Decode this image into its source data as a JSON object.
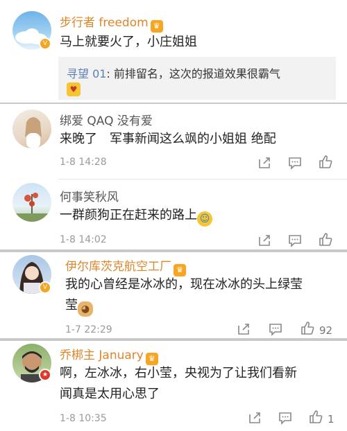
{
  "comments": [
    {
      "user": "步行者 freedom",
      "text": "马上就要火了，小庄姐姐",
      "reply": {
        "user": "寻望 01",
        "text": ": 前排留名，这次的报道效果很霸气"
      }
    },
    {
      "user": "绑爱 QAQ 没有爱",
      "text": "来晚了　军事新闻这么飒的小姐姐 绝配",
      "time": "1-8 14:28"
    },
    {
      "user": "何事笑秋风",
      "text": "一群颜狗正在赶来的路上",
      "time": "1-8 14:02"
    },
    {
      "user": "伊尔库茨克航空工厂",
      "text_line1": "我的心曾经是冰冰的，现在冰冰的头上绿莹",
      "text_line2": "莹",
      "time": "1-7 22:29",
      "likes": "92"
    },
    {
      "user": "乔梆主 January",
      "text_line1": "啊，左冰冰，右小莹，央视为了让我们看新",
      "text_line2": "闻真是太用心思了",
      "time": "1-8 10:35",
      "likes": "1"
    }
  ],
  "colors": {
    "orange_name": "#e0842a",
    "gray_name": "#555555",
    "reply_user": "#5b7fb5"
  },
  "icons": [
    "share-icon",
    "comment-icon",
    "like-icon",
    "vip-crown-icon",
    "verified-badge-icon",
    "laugh-cry-emoji",
    "doge-emoji"
  ]
}
